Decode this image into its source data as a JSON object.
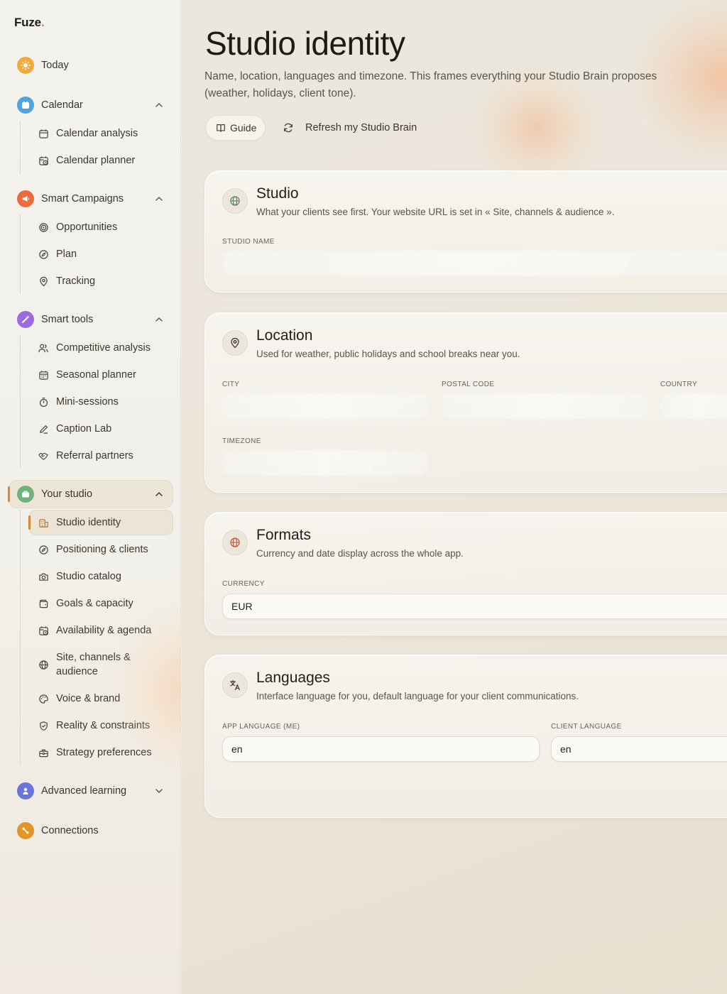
{
  "app": {
    "logo": "Fuze",
    "logo_dot": "."
  },
  "sidebar": {
    "today": "Today",
    "calendar": {
      "label": "Calendar",
      "items": [
        "Calendar analysis",
        "Calendar planner"
      ]
    },
    "smart_campaigns": {
      "label": "Smart Campaigns",
      "items": [
        "Opportunities",
        "Plan",
        "Tracking"
      ]
    },
    "smart_tools": {
      "label": "Smart tools",
      "items": [
        "Competitive analysis",
        "Seasonal planner",
        "Mini-sessions",
        "Caption Lab",
        "Referral partners"
      ]
    },
    "your_studio": {
      "label": "Your studio",
      "items": [
        "Studio identity",
        "Positioning & clients",
        "Studio catalog",
        "Goals & capacity",
        "Availability & agenda",
        "Site, channels & audience",
        "Voice & brand",
        "Reality & constraints",
        "Strategy preferences"
      ]
    },
    "advanced_learning": "Advanced learning",
    "connections": "Connections"
  },
  "header": {
    "title": "Studio identity",
    "subtitle": "Name, location, languages and timezone. This frames everything your Studio Brain proposes (weather, holidays, client tone).",
    "guide_label": "Guide",
    "refresh_label": "Refresh my Studio Brain"
  },
  "cards": {
    "studio": {
      "title": "Studio",
      "desc": "What your clients see first. Your website URL is set in « Site, channels & audience ».",
      "studio_name_label": "Studio name"
    },
    "location": {
      "title": "Location",
      "desc": "Used for weather, public holidays and school breaks near you.",
      "city_label": "City",
      "postal_label": "Postal code",
      "country_label": "Country",
      "timezone_label": "Timezone"
    },
    "formats": {
      "title": "Formats",
      "desc": "Currency and date display across the whole app.",
      "currency_label": "Currency",
      "currency_value": "EUR"
    },
    "languages": {
      "title": "Languages",
      "desc": "Interface language for you, default language for your client communications.",
      "app_lang_label": "App language (me)",
      "app_lang_value": "en",
      "client_lang_label": "Client language",
      "client_lang_value": "en"
    }
  },
  "colors": {
    "accent": "#d08a35",
    "today_icon": "#f2a93b",
    "calendar_icon": "#4fa3e0",
    "campaigns_icon": "#ec6a3c",
    "tools_icon": "#9b6ce0",
    "studio_icon": "#6fb37a",
    "learning_icon": "#6b74dc",
    "connections_icon": "#e59426"
  },
  "icons": {
    "today": "sun-icon",
    "calendar": "calendar-icon",
    "campaigns": "megaphone-icon",
    "tools": "wand-icon",
    "studio": "briefcase-icon",
    "learning": "graduation-icon",
    "connections": "plug-icon"
  }
}
